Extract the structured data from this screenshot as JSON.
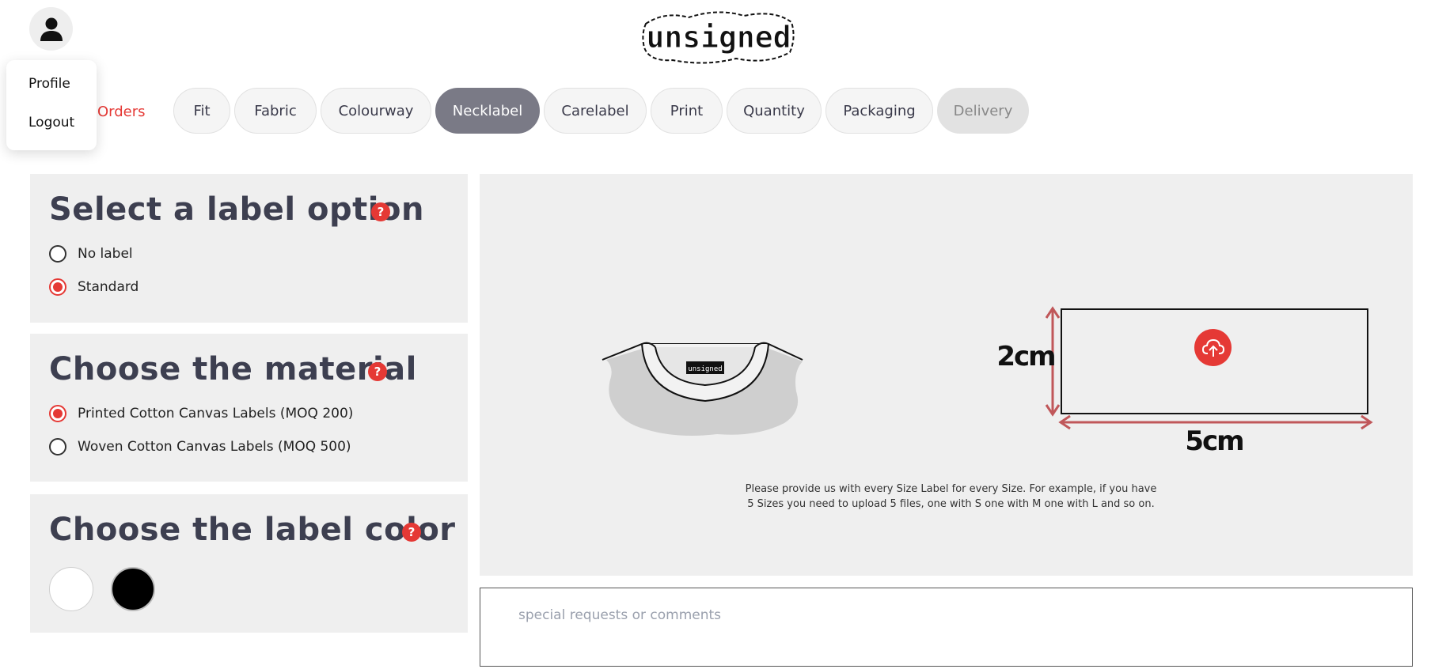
{
  "user_menu": {
    "items": [
      "Profile",
      "Logout"
    ]
  },
  "orders_link": "Orders",
  "logo_text": "unsigned",
  "tabs": [
    {
      "label": "Fit",
      "state": "default"
    },
    {
      "label": "Fabric",
      "state": "default"
    },
    {
      "label": "Colourway",
      "state": "default"
    },
    {
      "label": "Necklabel",
      "state": "active"
    },
    {
      "label": "Carelabel",
      "state": "default"
    },
    {
      "label": "Print",
      "state": "default"
    },
    {
      "label": "Quantity",
      "state": "default"
    },
    {
      "label": "Packaging",
      "state": "default"
    },
    {
      "label": "Delivery",
      "state": "disabled"
    }
  ],
  "label_option": {
    "title": "Select a label option",
    "help": "?",
    "options": [
      {
        "label": "No label",
        "checked": false
      },
      {
        "label": "Standard",
        "checked": true
      }
    ]
  },
  "material": {
    "title": "Choose the material",
    "help": "?",
    "options": [
      {
        "label": "Printed Cotton Canvas Labels (MOQ 200)",
        "checked": true
      },
      {
        "label": "Woven Cotton Canvas Labels (MOQ 500)",
        "checked": false
      }
    ]
  },
  "label_color": {
    "title": "Choose the label color",
    "help": "?",
    "swatches": [
      "#ffffff",
      "#000000"
    ]
  },
  "preview": {
    "width_label": "5cm",
    "height_label": "2cm",
    "instructions_line1": "Please provide us with every Size Label for every Size. For example, if you have",
    "instructions_line2": "5 Sizes you need to upload 5 files, one with S one with M one with L and so on."
  },
  "comments": {
    "placeholder": "special requests or comments"
  },
  "colors": {
    "accent": "#e53935",
    "active_tab": "#7a7a86",
    "panel_bg": "#efefef",
    "dimension_arrow": "#c0575a"
  }
}
